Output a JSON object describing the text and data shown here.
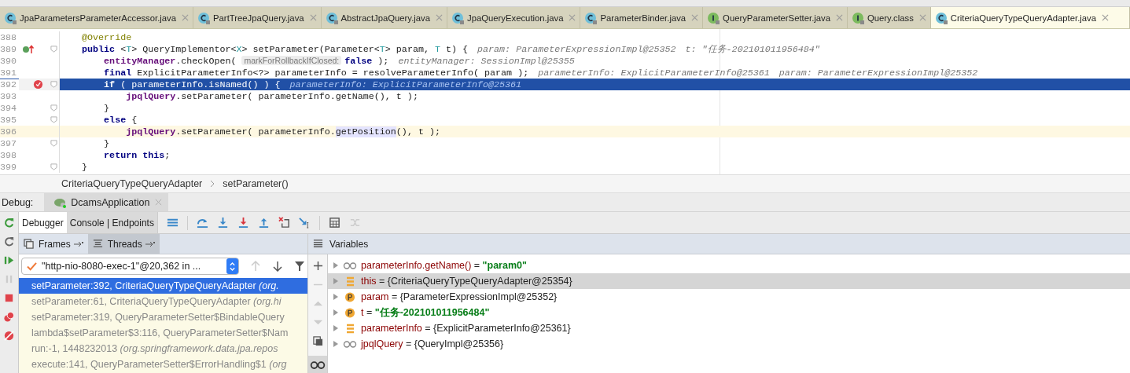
{
  "editor_tabs": [
    {
      "label": "JpaParametersParameterAccessor.java",
      "kind": "class",
      "selected": false
    },
    {
      "label": "PartTreeJpaQuery.java",
      "kind": "class",
      "selected": false
    },
    {
      "label": "AbstractJpaQuery.java",
      "kind": "class",
      "selected": false
    },
    {
      "label": "JpaQueryExecution.java",
      "kind": "class",
      "selected": false
    },
    {
      "label": "ParameterBinder.java",
      "kind": "class",
      "selected": false
    },
    {
      "label": "QueryParameterSetter.java",
      "kind": "interface",
      "selected": false
    },
    {
      "label": "Query.class",
      "kind": "interface",
      "selected": false
    },
    {
      "label": "CriteriaQueryTypeQueryAdapter.java",
      "kind": "class",
      "selected": true
    }
  ],
  "code_lines": [
    {
      "number": "388",
      "selected": false,
      "caret_line": false,
      "implements": false,
      "breakpoint": false,
      "fold": false,
      "tokens": [
        {
          "kind": "annotation",
          "text": "    @Override"
        }
      ]
    },
    {
      "number": "389",
      "selected": false,
      "caret_line": false,
      "implements": true,
      "breakpoint": false,
      "fold": true,
      "tokens": [
        {
          "kind": "keyword",
          "text": "    public "
        },
        {
          "kind": "plain",
          "text": "<"
        },
        {
          "kind": "typeparam",
          "text": "T"
        },
        {
          "kind": "plain",
          "text": "> QueryImplementor<"
        },
        {
          "kind": "typeparam",
          "text": "X"
        },
        {
          "kind": "plain",
          "text": "> setParameter(Parameter<"
        },
        {
          "kind": "typeparam",
          "text": "T"
        },
        {
          "kind": "plain",
          "text": "> param, "
        },
        {
          "kind": "typeparam",
          "text": "T"
        },
        {
          "kind": "plain",
          "text": " t) {"
        }
      ],
      "hints": [
        "param: ParameterExpressionImpl@25352",
        "t: \"任务-202101011956484\""
      ]
    },
    {
      "number": "390",
      "selected": false,
      "caret_line": false,
      "implements": false,
      "breakpoint": false,
      "fold": false,
      "tokens": [
        {
          "kind": "field",
          "text": "        entityManager"
        },
        {
          "kind": "plain",
          "text": ".checkOpen( "
        },
        {
          "kind": "param-hint",
          "text": "markForRollbackIfClosed:"
        },
        {
          "kind": "keyword",
          "text": "false"
        },
        {
          "kind": "plain",
          "text": " );"
        }
      ],
      "hints": [
        "entityManager: SessionImpl@25355"
      ]
    },
    {
      "number": "391",
      "selected": false,
      "caret_line": false,
      "implements": false,
      "breakpoint": false,
      "fold": false,
      "tokens": [
        {
          "kind": "keyword",
          "text": "        final "
        },
        {
          "kind": "plain",
          "text": "ExplicitParameterInfo<?> parameterInfo = resolveParameterInfo( param );"
        }
      ],
      "hints": [
        "parameterInfo: ExplicitParameterInfo@25361",
        "param: ParameterExpressionImpl@25352"
      ]
    },
    {
      "number": "392",
      "selected": true,
      "caret_line": false,
      "implements": false,
      "breakpoint": true,
      "fold": true,
      "tokens": [
        {
          "kind": "keyword",
          "text": "        if "
        },
        {
          "kind": "plain",
          "text": "( parameterInfo.isNamed() ) {"
        }
      ],
      "hints": [
        "parameterInfo: ExplicitParameterInfo@25361"
      ]
    },
    {
      "number": "393",
      "selected": false,
      "caret_line": false,
      "implements": false,
      "breakpoint": false,
      "fold": false,
      "tokens": [
        {
          "kind": "field",
          "text": "            jpqlQuery"
        },
        {
          "kind": "plain",
          "text": ".setParameter( parameterInfo.getName(), t );"
        }
      ]
    },
    {
      "number": "394",
      "selected": false,
      "caret_line": false,
      "implements": false,
      "breakpoint": false,
      "fold": true,
      "tokens": [
        {
          "kind": "plain",
          "text": "        }"
        }
      ]
    },
    {
      "number": "395",
      "selected": false,
      "caret_line": false,
      "implements": false,
      "breakpoint": false,
      "fold": true,
      "tokens": [
        {
          "kind": "keyword",
          "text": "        else "
        },
        {
          "kind": "plain",
          "text": "{"
        }
      ]
    },
    {
      "number": "396",
      "selected": false,
      "caret_line": true,
      "implements": false,
      "breakpoint": false,
      "fold": false,
      "tokens": [
        {
          "kind": "field",
          "text": "            jpqlQuery"
        },
        {
          "kind": "plain",
          "text": ".setParameter( parameterInfo."
        },
        {
          "kind": "highlight",
          "text": "getPosition"
        },
        {
          "kind": "plain",
          "text": "(), t );"
        }
      ]
    },
    {
      "number": "397",
      "selected": false,
      "caret_line": false,
      "implements": false,
      "breakpoint": false,
      "fold": true,
      "tokens": [
        {
          "kind": "plain",
          "text": "        }"
        }
      ]
    },
    {
      "number": "398",
      "selected": false,
      "caret_line": false,
      "implements": false,
      "breakpoint": false,
      "fold": false,
      "tokens": [
        {
          "kind": "keyword",
          "text": "        return this"
        },
        {
          "kind": "plain",
          "text": ";"
        }
      ]
    },
    {
      "number": "399",
      "selected": false,
      "caret_line": false,
      "implements": false,
      "breakpoint": false,
      "fold": true,
      "tokens": [
        {
          "kind": "plain",
          "text": "    }"
        }
      ]
    }
  ],
  "breadcrumb": [
    "CriteriaQueryTypeQueryAdapter",
    "setParameter()"
  ],
  "debug": {
    "label": "Debug:",
    "session": "DcamsApplication",
    "tabs": [
      {
        "label": "Debugger",
        "selected": true
      },
      {
        "label": "Console | Endpoints",
        "selected": false
      }
    ],
    "frame_tabs": [
      {
        "label": "Frames",
        "selected": false
      },
      {
        "label": "Threads",
        "selected": true
      }
    ],
    "variables_title": "Variables",
    "thread": "\"http-nio-8080-exec-1\"@20,362 in ...",
    "frames": [
      {
        "method": "setParameter:392, CriteriaQueryTypeQueryAdapter",
        "package": "(org.",
        "selected": true
      },
      {
        "method": "setParameter:61, CriteriaQueryTypeQueryAdapter",
        "package": "(org.hi",
        "selected": false
      },
      {
        "method": "setParameter:319, QueryParameterSetter$BindableQuery",
        "selected": false
      },
      {
        "method": "lambda$setParameter$3:116, QueryParameterSetter$Nam",
        "selected": false
      },
      {
        "method": "run:-1, 1448232013",
        "package": "(org.springframework.data.jpa.repos",
        "selected": false
      },
      {
        "method": "execute:141, QueryParameterSetter$ErrorHandling$1",
        "package": "(org",
        "selected": false
      }
    ],
    "variables": [
      {
        "kind": "watch",
        "name": "parameterInfo.getName()",
        "operator": "=",
        "value": "\"param0\"",
        "emphasized": true,
        "selected": false
      },
      {
        "kind": "field",
        "name": "this",
        "operator": "=",
        "value": "{CriteriaQueryTypeQueryAdapter@25354}",
        "emphasized": false,
        "selected": true
      },
      {
        "kind": "param",
        "name": "param",
        "operator": "=",
        "value": "{ParameterExpressionImpl@25352}",
        "emphasized": false,
        "selected": false
      },
      {
        "kind": "param",
        "name": "t",
        "operator": "=",
        "value": "\"任务-202101011956484\"",
        "emphasized": true,
        "selected": false
      },
      {
        "kind": "field",
        "name": "parameterInfo",
        "operator": "=",
        "value": "{ExplicitParameterInfo@25361}",
        "emphasized": false,
        "selected": false
      },
      {
        "kind": "watch",
        "name": "jpqlQuery",
        "operator": "=",
        "value": "{QueryImpl@25356}",
        "emphasized": false,
        "selected": false
      }
    ]
  }
}
